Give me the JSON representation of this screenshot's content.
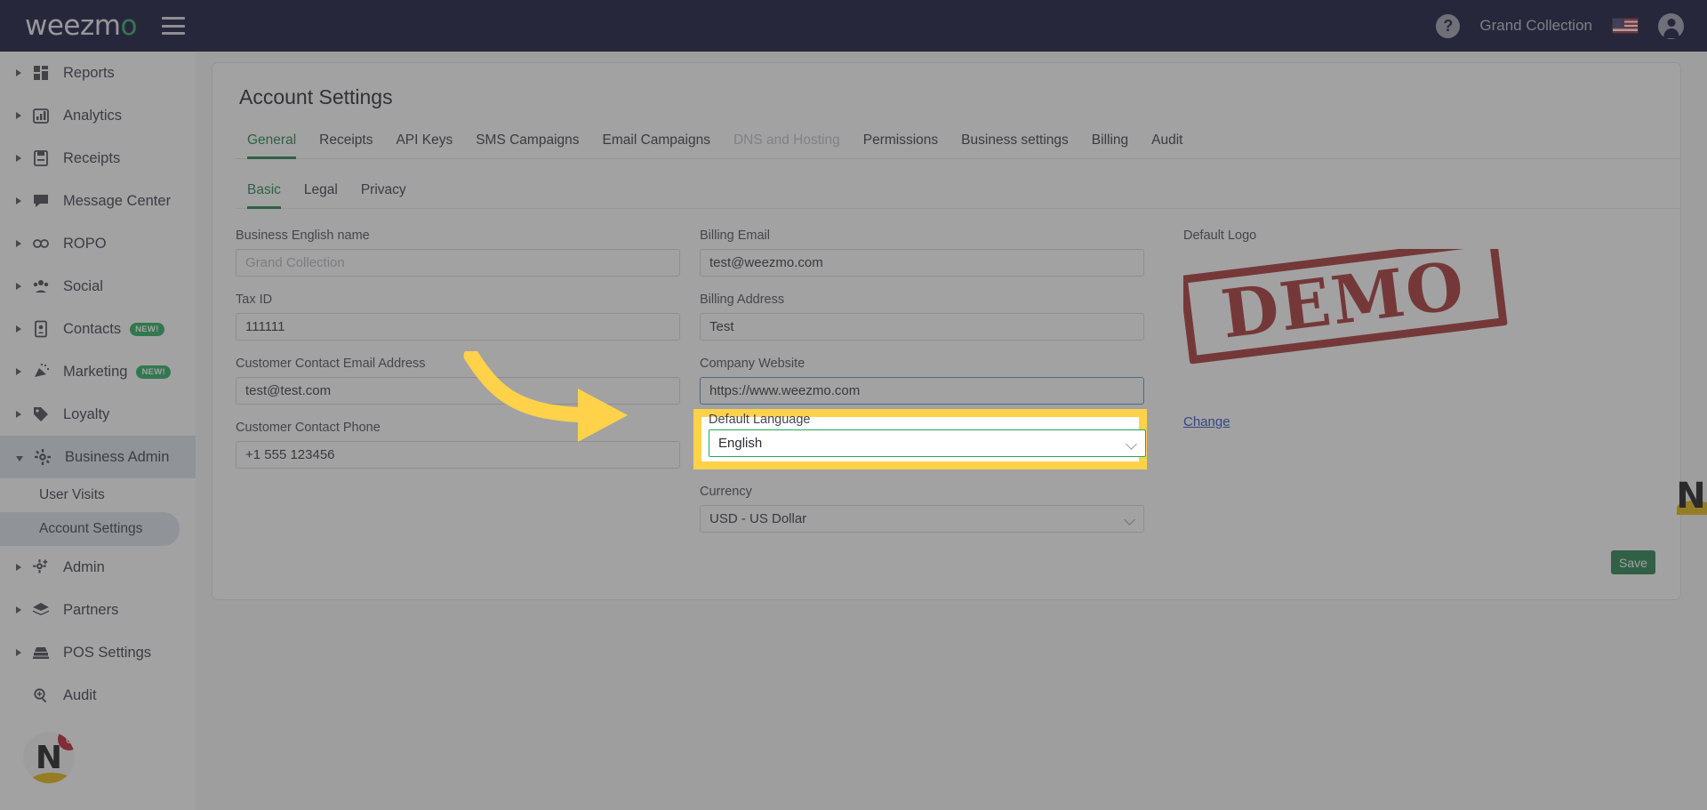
{
  "topbar": {
    "logo_main": "weezm",
    "logo_accent": "o",
    "menu_icon": "hamburger-icon",
    "help_icon": "?",
    "account_name": "Grand Collection",
    "flag": "us-flag-icon",
    "avatar_icon": "user-avatar-icon"
  },
  "sidebar": {
    "items": [
      {
        "label": "Reports",
        "icon": "dashboard-icon",
        "badge": "",
        "expandable": true,
        "expanded": false,
        "active": false
      },
      {
        "label": "Analytics",
        "icon": "chart-icon",
        "badge": "",
        "expandable": true,
        "expanded": false,
        "active": false
      },
      {
        "label": "Receipts",
        "icon": "receipt-icon",
        "badge": "",
        "expandable": true,
        "expanded": false,
        "active": false
      },
      {
        "label": "Message Center",
        "icon": "chat-icon",
        "badge": "",
        "expandable": true,
        "expanded": false,
        "active": false
      },
      {
        "label": "ROPO",
        "icon": "infinity-icon",
        "badge": "",
        "expandable": true,
        "expanded": false,
        "active": false
      },
      {
        "label": "Social",
        "icon": "people-icon",
        "badge": "",
        "expandable": true,
        "expanded": false,
        "active": false
      },
      {
        "label": "Contacts",
        "icon": "contact-card-icon",
        "badge": "NEW!",
        "expandable": true,
        "expanded": false,
        "active": false
      },
      {
        "label": "Marketing",
        "icon": "megaphone-icon",
        "badge": "NEW!",
        "expandable": true,
        "expanded": false,
        "active": false
      },
      {
        "label": "Loyalty",
        "icon": "tag-icon",
        "badge": "",
        "expandable": true,
        "expanded": false,
        "active": false
      },
      {
        "label": "Business Admin",
        "icon": "gear-icon",
        "badge": "",
        "expandable": true,
        "expanded": true,
        "active": true
      },
      {
        "label": "Admin",
        "icon": "gear-plus-icon",
        "badge": "",
        "expandable": true,
        "expanded": false,
        "active": false
      },
      {
        "label": "Partners",
        "icon": "layers-icon",
        "badge": "",
        "expandable": true,
        "expanded": false,
        "active": false
      },
      {
        "label": "POS Settings",
        "icon": "cash-register-icon",
        "badge": "",
        "expandable": true,
        "expanded": false,
        "active": false
      },
      {
        "label": "Audit",
        "icon": "magnifier-icon",
        "badge": "",
        "expandable": false,
        "expanded": false,
        "active": false
      }
    ],
    "subitems": [
      {
        "label": "User Visits",
        "selected": false
      },
      {
        "label": "Account Settings",
        "selected": true
      }
    ],
    "brand": {
      "letter": "N",
      "badge_count": "6"
    }
  },
  "page": {
    "title": "Account Settings",
    "tabs": [
      {
        "label": "General",
        "active": true,
        "disabled": false
      },
      {
        "label": "Receipts",
        "active": false,
        "disabled": false
      },
      {
        "label": "API Keys",
        "active": false,
        "disabled": false
      },
      {
        "label": "SMS Campaigns",
        "active": false,
        "disabled": false
      },
      {
        "label": "Email Campaigns",
        "active": false,
        "disabled": false
      },
      {
        "label": "DNS and Hosting",
        "active": false,
        "disabled": true
      },
      {
        "label": "Permissions",
        "active": false,
        "disabled": false
      },
      {
        "label": "Business settings",
        "active": false,
        "disabled": false
      },
      {
        "label": "Billing",
        "active": false,
        "disabled": false
      },
      {
        "label": "Audit",
        "active": false,
        "disabled": false
      }
    ],
    "subtabs": [
      {
        "label": "Basic",
        "active": true
      },
      {
        "label": "Legal",
        "active": false
      },
      {
        "label": "Privacy",
        "active": false
      }
    ],
    "fields": {
      "business_name": {
        "label": "Business English name",
        "value": "",
        "placeholder": "Grand Collection"
      },
      "tax_id": {
        "label": "Tax ID",
        "value": "111111",
        "placeholder": ""
      },
      "contact_email": {
        "label": "Customer Contact Email Address",
        "value": "test@test.com",
        "placeholder": ""
      },
      "contact_phone": {
        "label": "Customer Contact Phone",
        "value": "+1 555 123456",
        "placeholder": ""
      },
      "billing_email": {
        "label": "Billing Email",
        "value": "test@weezmo.com",
        "placeholder": ""
      },
      "billing_address": {
        "label": "Billing Address",
        "value": "Test",
        "placeholder": ""
      },
      "company_website": {
        "label": "Company Website",
        "value": "https://www.weezmo.com",
        "placeholder": ""
      },
      "default_language": {
        "label": "Default Language",
        "value": "English",
        "placeholder": ""
      },
      "currency": {
        "label": "Currency",
        "value": "USD - US Dollar",
        "placeholder": ""
      }
    },
    "logo": {
      "label": "Default Logo",
      "image_text": "DEMO",
      "change_link": "Change"
    },
    "save_label": "Save",
    "corner_brand_letter": "N"
  },
  "colors": {
    "accent_green": "#1b7a46",
    "topbar_navy": "#080833",
    "highlight_yellow": "#ffd24a",
    "badge_red": "#b8142a",
    "link_blue": "#2244cc",
    "stamp_red": "#9e1b1b"
  }
}
